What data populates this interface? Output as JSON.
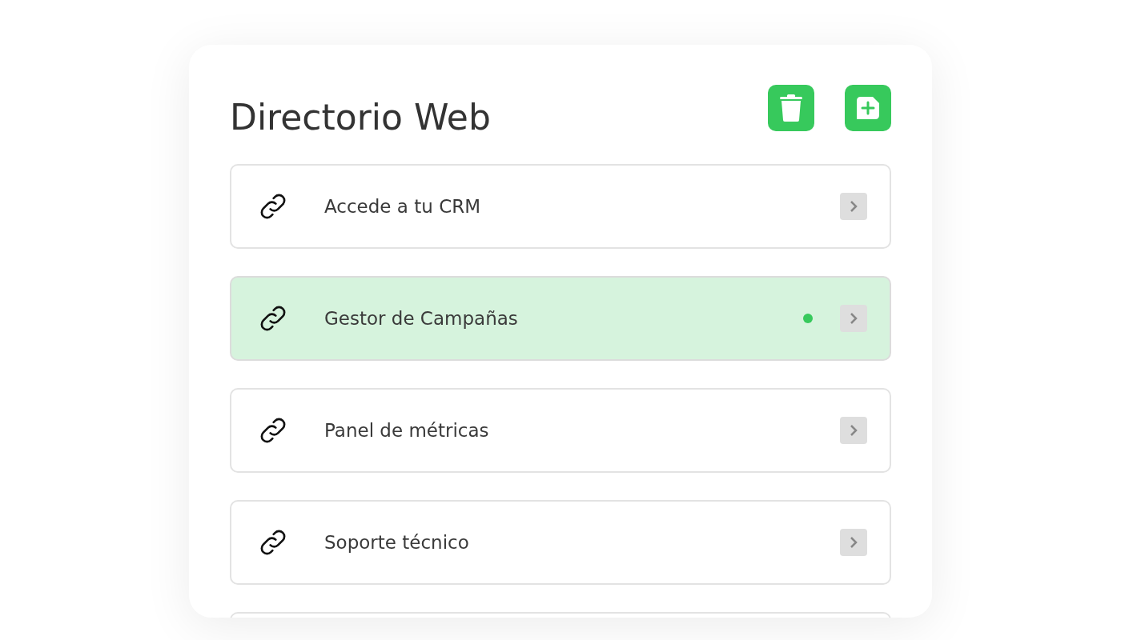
{
  "title": "Directorio Web",
  "links": [
    {
      "label": "Accede a tu CRM",
      "selected": false
    },
    {
      "label": "Gestor de Campañas",
      "selected": true
    },
    {
      "label": "Panel de métricas",
      "selected": false
    },
    {
      "label": "Soporte técnico",
      "selected": false
    }
  ]
}
